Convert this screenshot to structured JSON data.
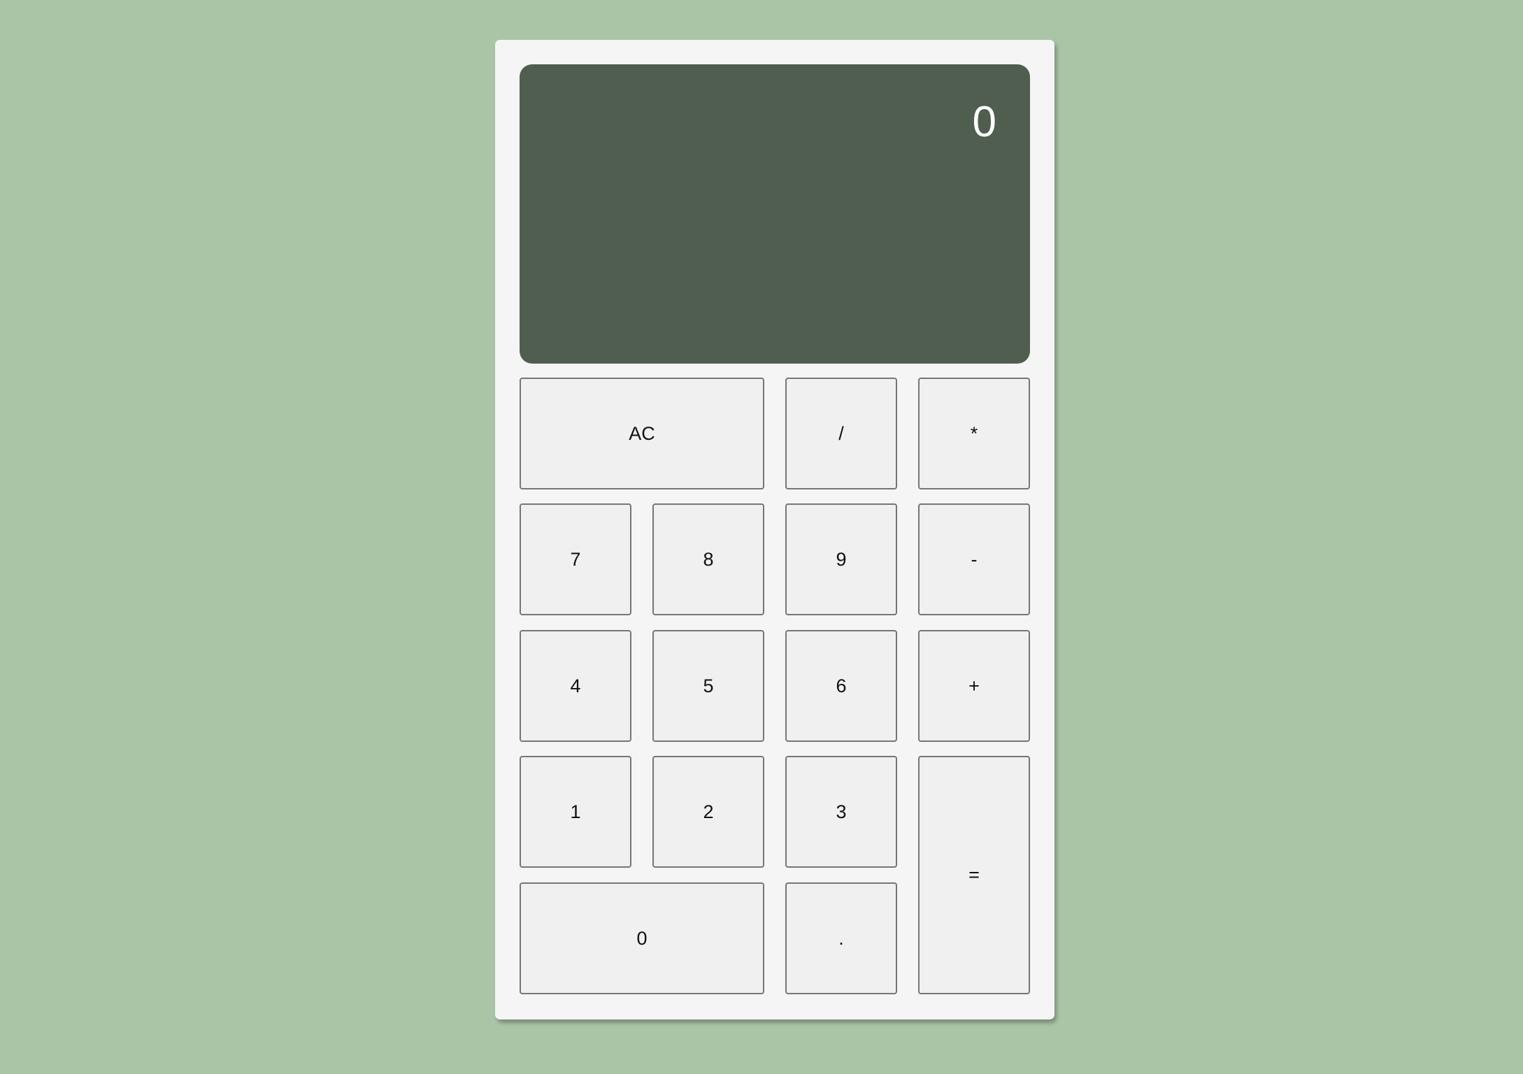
{
  "display": {
    "value": "0"
  },
  "keys": {
    "ac": "AC",
    "divide": "/",
    "multiply": "*",
    "seven": "7",
    "eight": "8",
    "nine": "9",
    "minus": "-",
    "four": "4",
    "five": "5",
    "six": "6",
    "plus": "+",
    "one": "1",
    "two": "2",
    "three": "3",
    "equals": "=",
    "zero": "0",
    "decimal": "."
  },
  "colors": {
    "page_background": "#a9c5a6",
    "calculator_body": "#f5f5f5",
    "display_background": "#4f5e4e",
    "display_text": "#ffffff",
    "key_background": "#f0f0f0",
    "key_border": "#767676"
  }
}
